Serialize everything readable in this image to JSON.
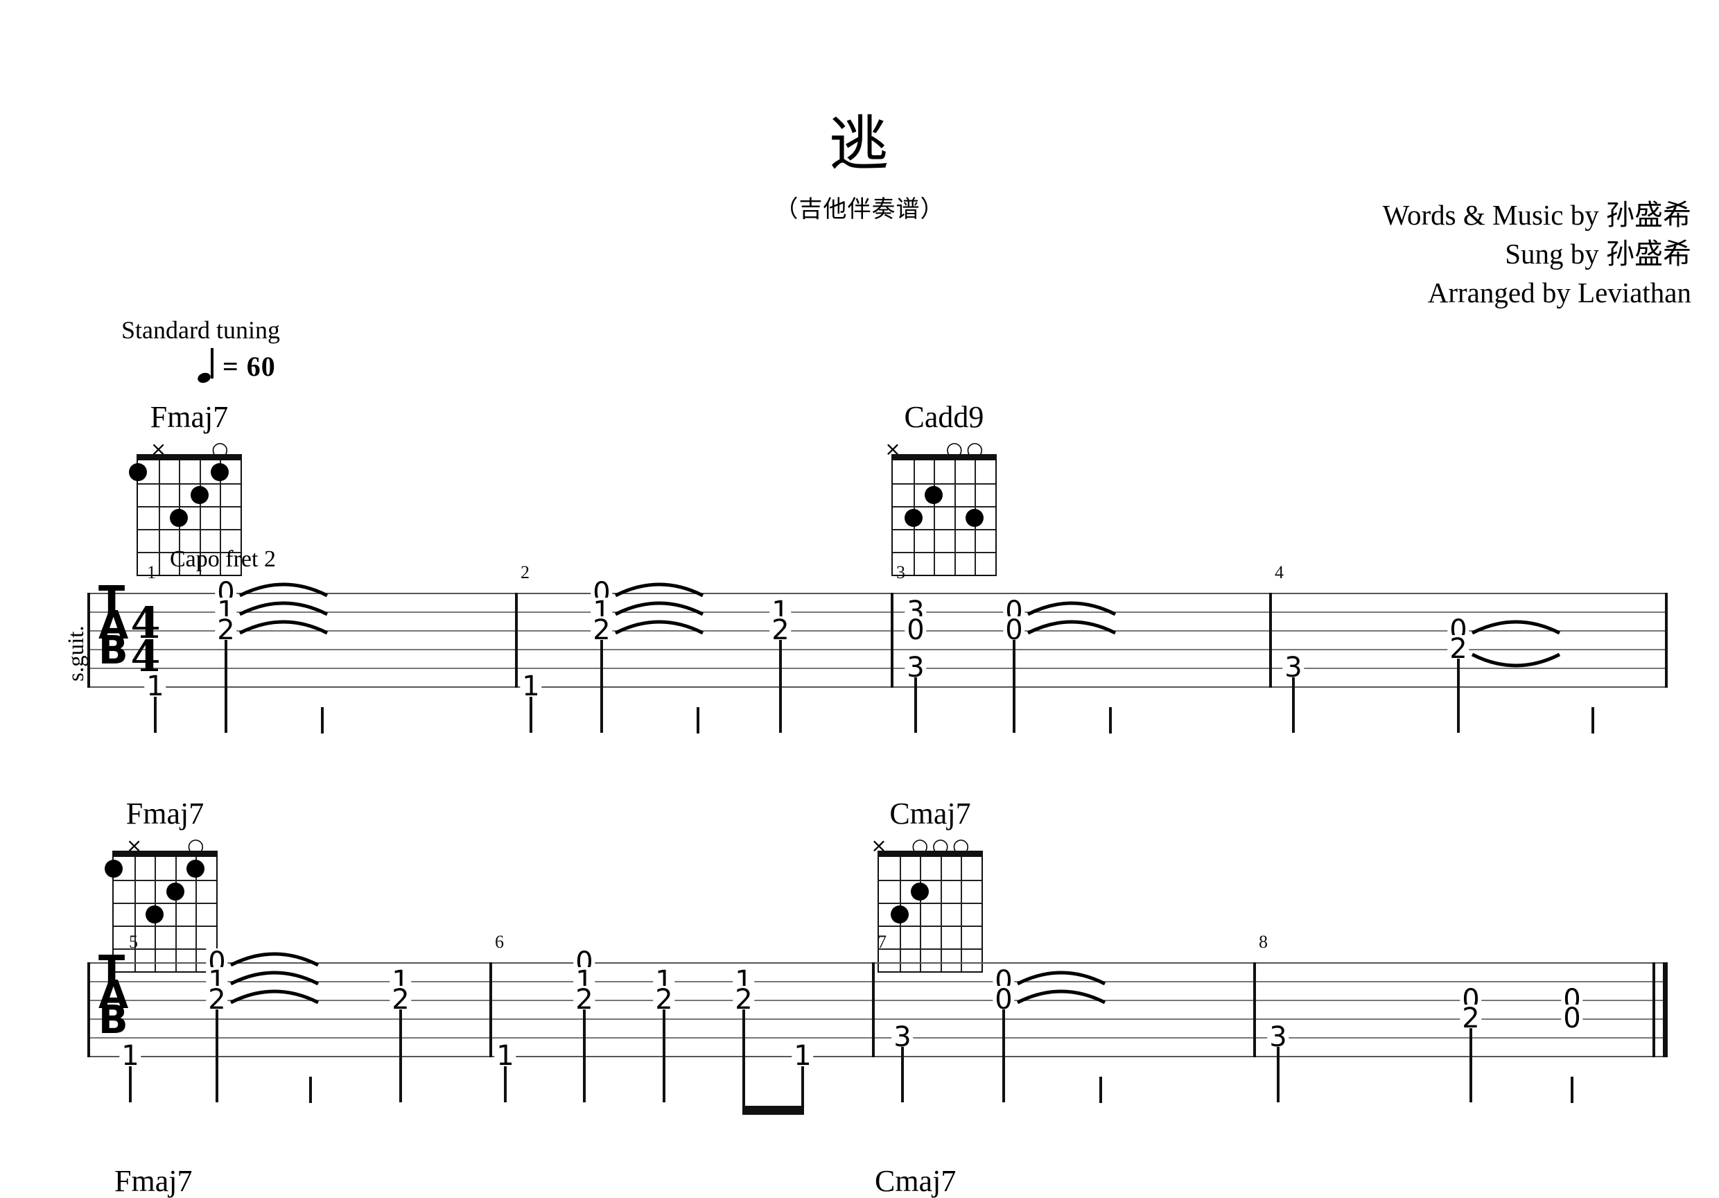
{
  "header": {
    "title": "逃",
    "subtitle": "（吉他伴奏谱）",
    "credits": [
      "Words & Music by 孙盛希",
      "Sung by 孙盛希",
      "Arranged by Leviathan"
    ]
  },
  "performance": {
    "tuning": "Standard tuning",
    "tempo_note": "quarter-note",
    "tempo_equals": "= 60",
    "tempo_bpm": 60,
    "capo": "Capo fret 2",
    "instrument_label": "s.guit.",
    "clef": [
      "T",
      "A",
      "B"
    ],
    "time_signature": {
      "top": "4",
      "bottom": "4"
    }
  },
  "chord_diagrams": [
    {
      "name": "Fmaj7",
      "system": 1,
      "open_marks": [
        {
          "string": 2,
          "mark": "×"
        },
        {
          "string": 5,
          "mark": "○"
        }
      ],
      "dots": [
        {
          "string": 1,
          "fret": 1
        },
        {
          "string": 5,
          "fret": 1
        },
        {
          "string": 4,
          "fret": 2
        },
        {
          "string": 3,
          "fret": 3
        }
      ]
    },
    {
      "name": "Cadd9",
      "system": 1,
      "open_marks": [
        {
          "string": 1,
          "mark": "×"
        },
        {
          "string": 4,
          "mark": "○"
        },
        {
          "string": 5,
          "mark": "○"
        }
      ],
      "dots": [
        {
          "string": 3,
          "fret": 2
        },
        {
          "string": 2,
          "fret": 3
        },
        {
          "string": 5,
          "fret": 3
        }
      ]
    },
    {
      "name": "Fmaj7",
      "system": 2,
      "open_marks": [
        {
          "string": 2,
          "mark": "×"
        },
        {
          "string": 5,
          "mark": "○"
        }
      ],
      "dots": [
        {
          "string": 1,
          "fret": 1
        },
        {
          "string": 5,
          "fret": 1
        },
        {
          "string": 4,
          "fret": 2
        },
        {
          "string": 3,
          "fret": 3
        }
      ]
    },
    {
      "name": "Cmaj7",
      "system": 2,
      "open_marks": [
        {
          "string": 1,
          "mark": "×"
        },
        {
          "string": 3,
          "mark": "○"
        },
        {
          "string": 4,
          "mark": "○"
        },
        {
          "string": 5,
          "mark": "○"
        }
      ],
      "dots": [
        {
          "string": 3,
          "fret": 2
        },
        {
          "string": 2,
          "fret": 3
        }
      ]
    }
  ],
  "bottom_chords": [
    {
      "name": "Fmaj7"
    },
    {
      "name": "Cmaj7"
    }
  ],
  "tab": {
    "strings": 6,
    "measure_numbers": [
      "1",
      "2",
      "3",
      "4",
      "5",
      "6",
      "7",
      "8"
    ],
    "systems": [
      {
        "index": 1,
        "measures": [
          {
            "number": "1",
            "notes": [
              {
                "string": 6,
                "fret": "1",
                "stem": true
              },
              {
                "string": 1,
                "fret": "0",
                "tie": true
              },
              {
                "string": 2,
                "fret": "1",
                "tie": true
              },
              {
                "string": 3,
                "fret": "2",
                "tie": true
              }
            ]
          },
          {
            "number": "2",
            "notes": [
              {
                "string": 6,
                "fret": "1",
                "stem": true
              },
              {
                "string": 1,
                "fret": "0",
                "tie": true
              },
              {
                "string": 2,
                "fret": "1",
                "tie": true
              },
              {
                "string": 3,
                "fret": "2",
                "tie": true
              },
              {
                "string": 2,
                "fret": "1",
                "stem": true
              },
              {
                "string": 3,
                "fret": "2",
                "stem": true
              }
            ]
          },
          {
            "number": "3",
            "notes": [
              {
                "string": 2,
                "fret": "3",
                "stem": true
              },
              {
                "string": 3,
                "fret": "0",
                "stem": true
              },
              {
                "string": 5,
                "fret": "3",
                "stem": true
              },
              {
                "string": 2,
                "fret": "0",
                "tie": true
              },
              {
                "string": 3,
                "fret": "0",
                "tie": true
              }
            ]
          },
          {
            "number": "4",
            "notes": [
              {
                "string": 5,
                "fret": "3",
                "stem": true
              },
              {
                "string": 3,
                "fret": "0",
                "tie": true
              },
              {
                "string": 4,
                "fret": "2",
                "tie": true
              }
            ]
          }
        ]
      },
      {
        "index": 2,
        "measures": [
          {
            "number": "5",
            "notes": [
              {
                "string": 6,
                "fret": "1",
                "stem": true
              },
              {
                "string": 1,
                "fret": "0",
                "tie": true
              },
              {
                "string": 2,
                "fret": "1",
                "tie": true
              },
              {
                "string": 3,
                "fret": "2",
                "tie": true
              },
              {
                "string": 2,
                "fret": "1",
                "stem": true
              },
              {
                "string": 3,
                "fret": "2",
                "stem": true
              }
            ]
          },
          {
            "number": "6",
            "notes": [
              {
                "string": 6,
                "fret": "1",
                "stem": true
              },
              {
                "string": 1,
                "fret": "0",
                "stem": true
              },
              {
                "string": 2,
                "fret": "1",
                "stem": true
              },
              {
                "string": 3,
                "fret": "2",
                "stem": true
              },
              {
                "string": 2,
                "fret": "1",
                "stem": true
              },
              {
                "string": 3,
                "fret": "2",
                "stem": true
              },
              {
                "string": 2,
                "fret": "1",
                "beamed": true
              },
              {
                "string": 3,
                "fret": "2",
                "beamed": true
              },
              {
                "string": 6,
                "fret": "1",
                "beamed": true
              }
            ]
          },
          {
            "number": "7",
            "notes": [
              {
                "string": 5,
                "fret": "3",
                "stem": true
              },
              {
                "string": 2,
                "fret": "0",
                "tie": true
              },
              {
                "string": 3,
                "fret": "0",
                "tie": true
              }
            ]
          },
          {
            "number": "8",
            "notes": [
              {
                "string": 5,
                "fret": "3",
                "stem": true
              },
              {
                "string": 3,
                "fret": "0",
                "stem": true
              },
              {
                "string": 4,
                "fret": "2",
                "stem": true
              },
              {
                "string": 3,
                "fret": "0",
                "stem": true
              },
              {
                "string": 4,
                "fret": "0",
                "stem": true
              }
            ]
          }
        ]
      }
    ]
  }
}
